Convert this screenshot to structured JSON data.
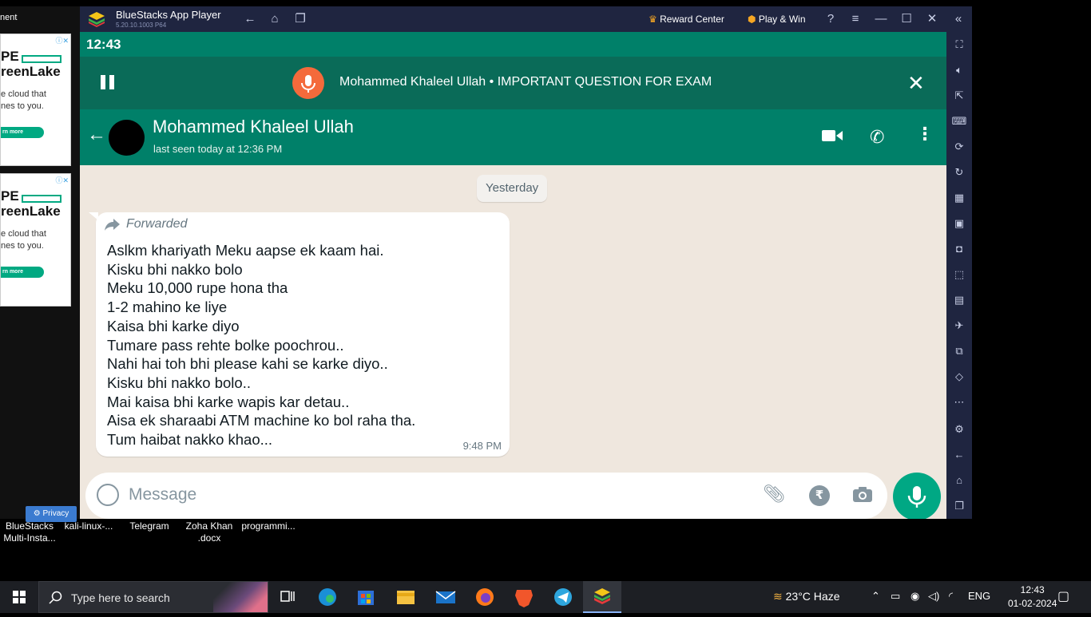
{
  "ad": {
    "title": "nent",
    "brand_line1": "PE",
    "brand_line2": "reenLake",
    "body_line1": "e cloud that",
    "body_line2": "nes to you.",
    "learn": "rn more",
    "privacy": "Privacy"
  },
  "bluestacks": {
    "app_name": "BlueStacks App Player",
    "version": "5.20.10.1003  P64",
    "reward_center": "Reward Center",
    "play_win": "Play & Win"
  },
  "android": {
    "time": "12:43",
    "voice_bar": {
      "title": "Mohammed Khaleel Ullah • IMPORTANT QUESTION FOR EXAM",
      "progress": 0.57
    },
    "chat": {
      "contact_name": "Mohammed Khaleel Ullah",
      "last_seen": "last seen today at 12:36 PM",
      "day_label": "Yesterday",
      "message": {
        "forwarded_label": "Forwarded",
        "lines": [
          "Aslkm khariyath Meku aapse ek kaam hai.",
          "Kisku bhi nakko bolo",
          "Meku 10,000 rupe hona tha",
          "1-2 mahino ke liye",
          "Kaisa bhi karke diyo",
          "Tumare pass rehte bolke poochrou..",
          "Nahi hai toh bhi please kahi se karke diyo..",
          "Kisku bhi nakko bolo..",
          "Mai kaisa bhi karke wapis kar detau..",
          "Aisa ek sharaabi ATM machine ko bol raha tha.",
          "Tum haibat nakko khao..."
        ],
        "time": "9:48 PM"
      },
      "composer_placeholder": "Message",
      "rupee_symbol": "₹"
    }
  },
  "desktop_icons": [
    {
      "line1": "BlueStacks",
      "line2": "Multi-Insta..."
    },
    {
      "line1": "kali-linux-...",
      "line2": ""
    },
    {
      "line1": "Telegram",
      "line2": ""
    },
    {
      "line1": "Zoha  Khan",
      "line2": ".docx"
    },
    {
      "line1": "programmi...",
      "line2": ""
    }
  ],
  "taskbar": {
    "search_placeholder": "Type here to search",
    "weather": "23°C  Haze",
    "language": "ENG",
    "time": "12:43",
    "date": "01-02-2024"
  },
  "colors": {
    "whatsapp_green": "#008069",
    "mic_green": "#00a884",
    "voice_orange": "#f46a3b",
    "bluestacks_bg": "#1f2540"
  }
}
